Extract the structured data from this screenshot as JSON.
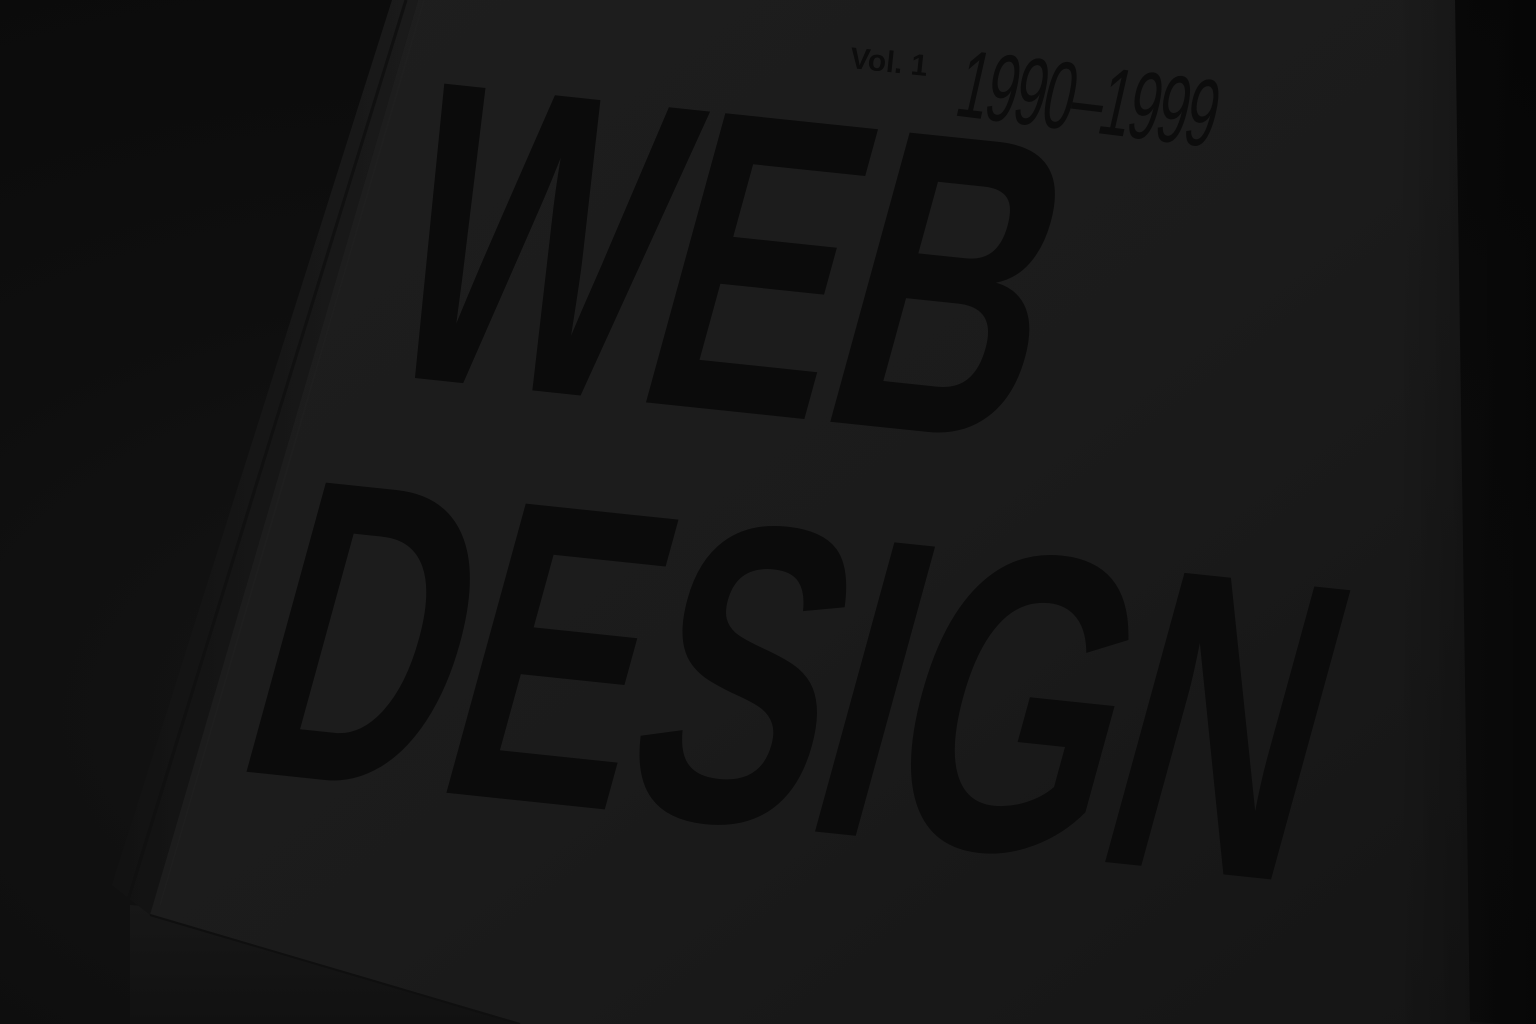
{
  "cover": {
    "volume": "Vol. 1",
    "years": "1990–1999",
    "title_line1": "WEB",
    "title_line2": "DESIGN"
  },
  "colors": {
    "background": "#0d0d0d",
    "cover": "#1b1b1b",
    "spine": "#161616",
    "ink": "#0b0b0b"
  }
}
